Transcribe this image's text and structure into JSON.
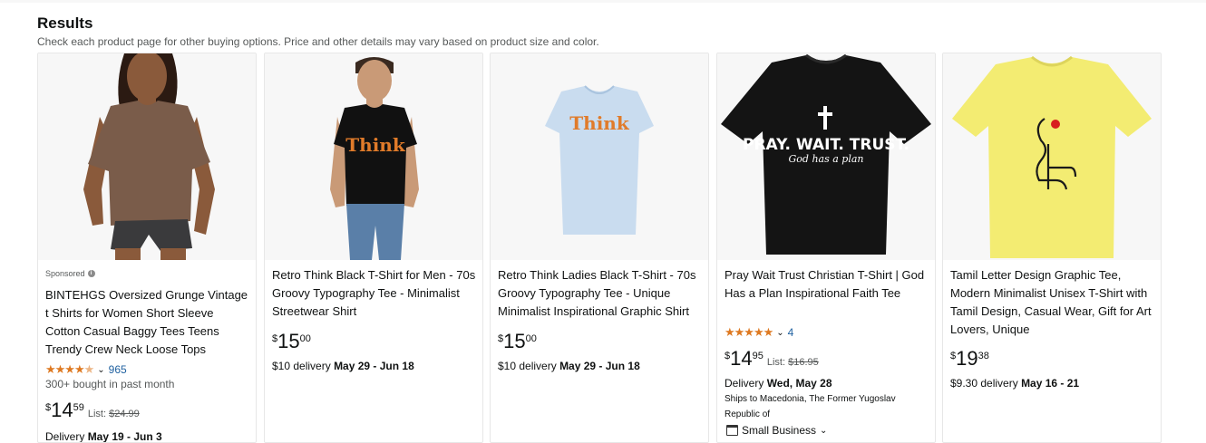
{
  "header": {
    "title": "Results",
    "subtitle": "Check each product page for other buying options. Price and other details may vary based on product size and color."
  },
  "products": [
    {
      "sponsored": "Sponsored",
      "title": "BINTEHGS Oversized Grunge Vintage t Shirts for Women Short Sleeve Cotton Casual Baggy Tees Teens Trendy Crew Neck Loose Tops",
      "rating_stars": 4.5,
      "rating_count": "965",
      "bought": "300+ bought in past month",
      "price_symbol": "$",
      "price_whole": "14",
      "price_frac": "59",
      "list_label": "List:",
      "list_price": "$24.99",
      "delivery_prefix": "Delivery",
      "delivery_date": "May 19 - Jun 3"
    },
    {
      "title": "Retro Think Black T-Shirt for Men - 70s Groovy Typography Tee - Minimalist Streetwear Shirt",
      "price_symbol": "$",
      "price_whole": "15",
      "price_frac": "00",
      "delivery_prefix": "$10 delivery",
      "delivery_date": "May 29 - Jun 18"
    },
    {
      "title": "Retro Think Ladies Black T-Shirt - 70s Groovy Typography Tee - Unique Minimalist Inspirational Graphic Shirt",
      "price_symbol": "$",
      "price_whole": "15",
      "price_frac": "00",
      "delivery_prefix": "$10 delivery",
      "delivery_date": "May 29 - Jun 18"
    },
    {
      "title": "Pray Wait Trust Christian T-Shirt | God Has a Plan Inspirational Faith Tee",
      "rating_stars": 5,
      "rating_count": "4",
      "price_symbol": "$",
      "price_whole": "14",
      "price_frac": "95",
      "list_label": "List:",
      "list_price": "$16.95",
      "delivery_prefix": "Delivery",
      "delivery_date": "Wed, May 28",
      "ships_to": "Ships to Macedonia, The Former Yugoslav Republic of",
      "badge": "Small Business"
    },
    {
      "title": "Tamil Letter Design Graphic Tee, Modern Minimalist Unisex T-Shirt with Tamil Design, Casual Wear, Gift for Art Lovers, Unique",
      "price_symbol": "$",
      "price_whole": "19",
      "price_frac": "38",
      "delivery_prefix": "$9.30 delivery",
      "delivery_date": "May 16 - 21"
    }
  ],
  "shirt_graphics": {
    "think": "Think",
    "pray_line1": "PRAY. WAIT. TRUST.",
    "pray_line2": "God has a plan"
  },
  "colors": {
    "star": "#de7921",
    "link": "#2162a1",
    "think_orange": "#e07b2a",
    "shirt_light_blue": "#c9dcef",
    "shirt_yellow": "#f3ec72"
  }
}
